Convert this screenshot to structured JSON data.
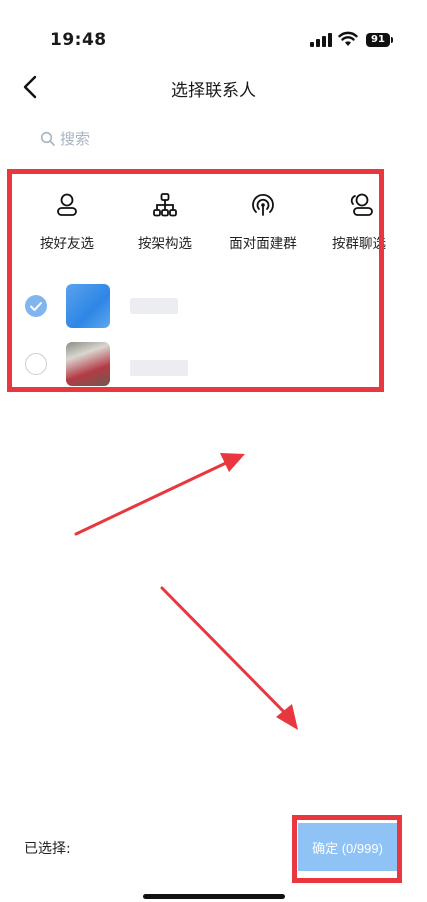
{
  "status_bar": {
    "time": "19:48",
    "battery": "91"
  },
  "nav": {
    "title": "选择联系人"
  },
  "search": {
    "placeholder": "搜索"
  },
  "actions": [
    {
      "label": "按好友选",
      "icon": "person-icon"
    },
    {
      "label": "按架构选",
      "icon": "org-chart-icon"
    },
    {
      "label": "面对面建群",
      "icon": "face-to-face-icon"
    },
    {
      "label": "按群聊选",
      "icon": "group-chat-icon"
    }
  ],
  "contacts": [
    {
      "selected": true
    },
    {
      "selected": false
    }
  ],
  "footer": {
    "selected_label": "已选择:",
    "confirm_label": "确定 (0/999)"
  },
  "colors": {
    "annotation_red": "#e8373e",
    "accent_blue": "#7fb6f0",
    "confirm_button": "#8fc3f5"
  }
}
